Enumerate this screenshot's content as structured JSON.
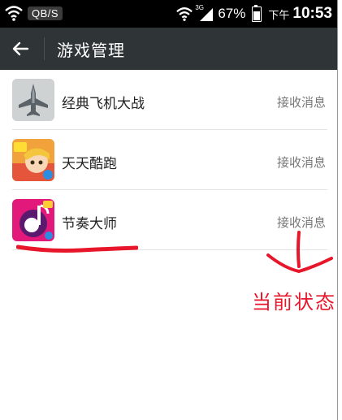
{
  "status_bar": {
    "rate": "QB/S",
    "network_type": "3G",
    "battery_percent": "67%",
    "battery_level": 0.67,
    "ampm": "下午",
    "time": "10:53"
  },
  "app_bar": {
    "title": "游戏管理"
  },
  "games": [
    {
      "name": "经典飞机大战",
      "action": "接收消息",
      "icon": "jet-fighter-icon"
    },
    {
      "name": "天天酷跑",
      "action": "接收消息",
      "icon": "parkour-character-icon"
    },
    {
      "name": "节奏大师",
      "action": "接收消息",
      "icon": "music-note-icon"
    }
  ],
  "annotation": {
    "text": "当前状态",
    "color": "#e8162a"
  }
}
